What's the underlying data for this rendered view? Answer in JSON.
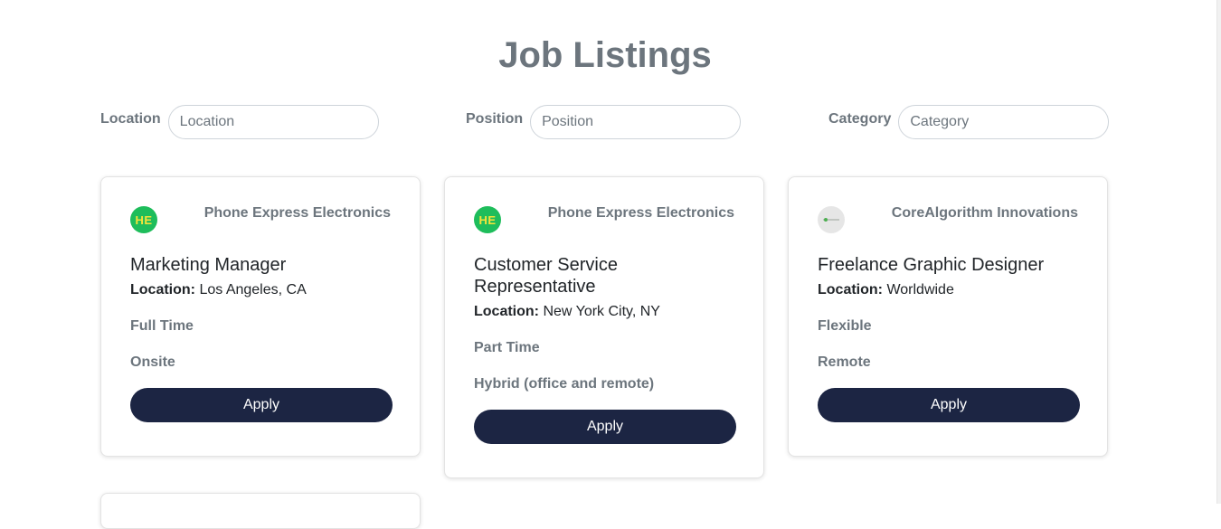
{
  "page": {
    "title": "Job Listings"
  },
  "filters": {
    "location": {
      "label": "Location",
      "placeholder": "Location"
    },
    "position": {
      "label": "Position",
      "placeholder": "Position"
    },
    "category": {
      "label": "Category",
      "placeholder": "Category"
    }
  },
  "jobs": [
    {
      "logo": {
        "text": "HE",
        "icon": "he-logo-icon",
        "bg_color": "#1ebd5b",
        "text_color": "#f6e33a"
      },
      "company": "Phone Express Electronics",
      "title": "Marketing Manager",
      "location_label": "Location:",
      "location": "Los Angeles, CA",
      "employment_type": "Full Time",
      "work_mode": "Onsite",
      "apply_label": "Apply"
    },
    {
      "logo": {
        "text": "HE",
        "icon": "he-logo-icon",
        "bg_color": "#1ebd5b",
        "text_color": "#f6e33a"
      },
      "company": "Phone Express Electronics",
      "title": "Customer Service Representative",
      "location_label": "Location:",
      "location": "New York City, NY",
      "employment_type": "Part Time",
      "work_mode": "Hybrid (office and remote)",
      "apply_label": "Apply"
    },
    {
      "logo": {
        "text": "",
        "icon": "corealgorithm-logo-icon",
        "bg_color": "#e6e6e6"
      },
      "company": "CoreAlgorithm Innovations",
      "title": "Freelance Graphic Designer",
      "location_label": "Location:",
      "location": "Worldwide",
      "employment_type": "Flexible",
      "work_mode": "Remote",
      "apply_label": "Apply"
    }
  ],
  "colors": {
    "accent_button": "#1c2543",
    "muted_text": "#6c757d",
    "title_text": "#212529"
  }
}
